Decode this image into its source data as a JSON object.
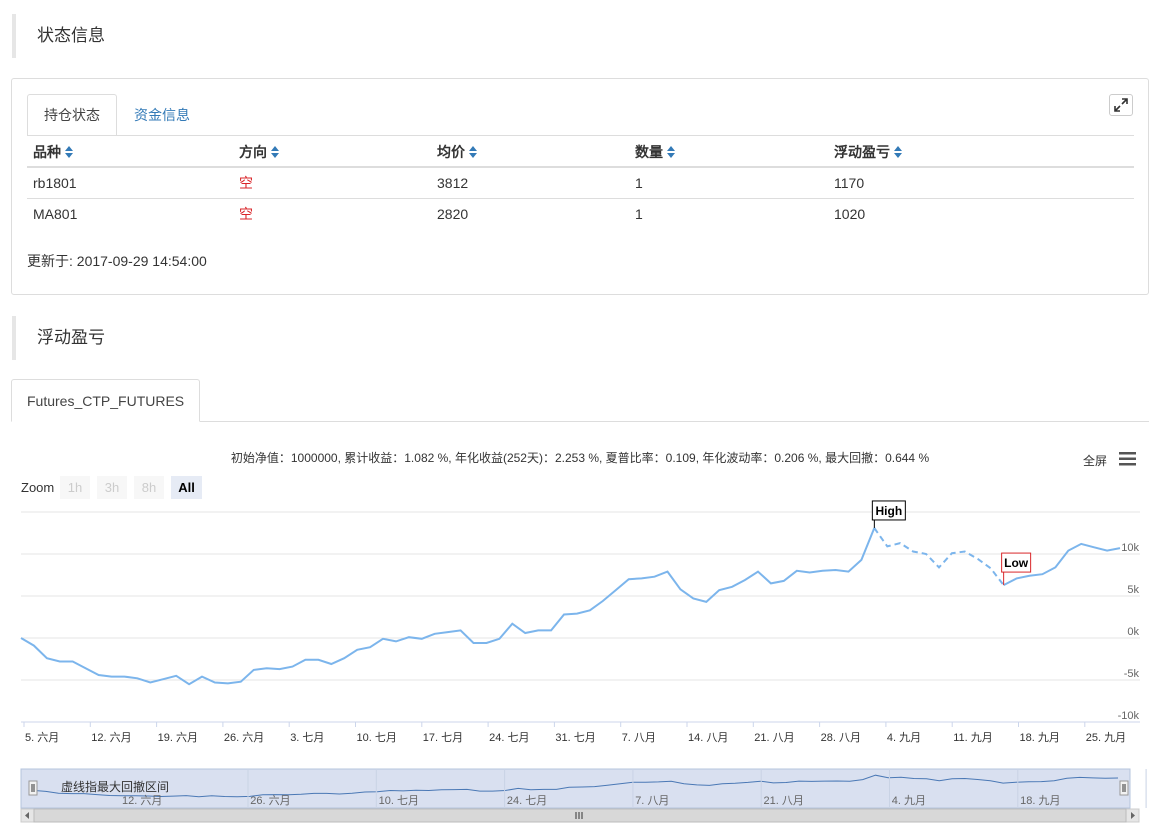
{
  "section1": {
    "title": "状态信息"
  },
  "tabs": [
    {
      "label": "持仓状态"
    },
    {
      "label": "资金信息"
    }
  ],
  "table": {
    "headers": [
      "品种",
      "方向",
      "均价",
      "数量",
      "浮动盈亏"
    ],
    "rows": [
      [
        "rb1801",
        "空",
        "3812",
        "1",
        "1170"
      ],
      [
        "MA801",
        "空",
        "2820",
        "1",
        "1020"
      ]
    ]
  },
  "updated": "更新于: 2017-09-29 14:54:00",
  "section2": {
    "title": "浮动盈亏"
  },
  "chart_tab": {
    "label": "Futures_CTP_FUTURES"
  },
  "chart_stats": "初始净值：1000000, 累计收益：1.082 %, 年化收益(252天)：2.253 %, 夏普比率：0.109, 年化波动率：0.206 %, 最大回撤：0.644 %",
  "fullscreen_label": "全屏",
  "zoom": {
    "label": "Zoom",
    "buttons": [
      "1h",
      "3h",
      "8h",
      "All"
    ],
    "active": "All"
  },
  "navigator_note": "虚线指最大回撤区间",
  "colors": {
    "line": "#7cb5ec",
    "link": "#337ab7",
    "short": "#d9262a",
    "low_flag": "#d9262a"
  },
  "chart_data": {
    "type": "line",
    "title": "",
    "y_ticks": [
      "10k",
      "5k",
      "0k",
      "-5k",
      "-10k"
    ],
    "ylim": [
      -10000,
      15000
    ],
    "x_ticks": [
      "5. 六月",
      "12. 六月",
      "19. 六月",
      "26. 六月",
      "3. 七月",
      "10. 七月",
      "17. 七月",
      "24. 七月",
      "31. 七月",
      "7. 八月",
      "14. 八月",
      "21. 八月",
      "28. 八月",
      "4. 九月",
      "11. 九月",
      "18. 九月",
      "25. 九月"
    ],
    "navigator_x_ticks": [
      "12. 六月",
      "26. 六月",
      "10. 七月",
      "24. 七月",
      "7. 八月",
      "21. 八月",
      "4. 九月",
      "18. 九月"
    ],
    "x_start": "2017-06-01",
    "x_end": "2017-09-29",
    "values": [
      0,
      -900,
      -2400,
      -2800,
      -2800,
      -3600,
      -4400,
      -4600,
      -4600,
      -4800,
      -5300,
      -4900,
      -4500,
      -5500,
      -4600,
      -5300,
      -5400,
      -5200,
      -3800,
      -3600,
      -3700,
      -3400,
      -2600,
      -2600,
      -3100,
      -2400,
      -1400,
      -1100,
      -100,
      -400,
      100,
      -100,
      500,
      700,
      900,
      -600,
      -600,
      -100,
      1700,
      600,
      900,
      900,
      2800,
      2900,
      3300,
      4400,
      5700,
      7000,
      7100,
      7300,
      7900,
      5800,
      4700,
      4300,
      5700,
      6100,
      6900,
      7900,
      6500,
      6800,
      8000,
      7800,
      8000,
      8100,
      7900,
      9300,
      13100,
      10900,
      11300,
      10300,
      10000,
      8400,
      10100,
      10300,
      9400,
      8300,
      6300,
      7100,
      7400,
      7600,
      8400,
      10400,
      11200,
      10800,
      10400,
      10700
    ],
    "drawdown_start_index": 66,
    "drawdown_end_index": 76,
    "flags": [
      {
        "label": "High",
        "index": 66
      },
      {
        "label": "Low",
        "index": 76
      }
    ]
  }
}
